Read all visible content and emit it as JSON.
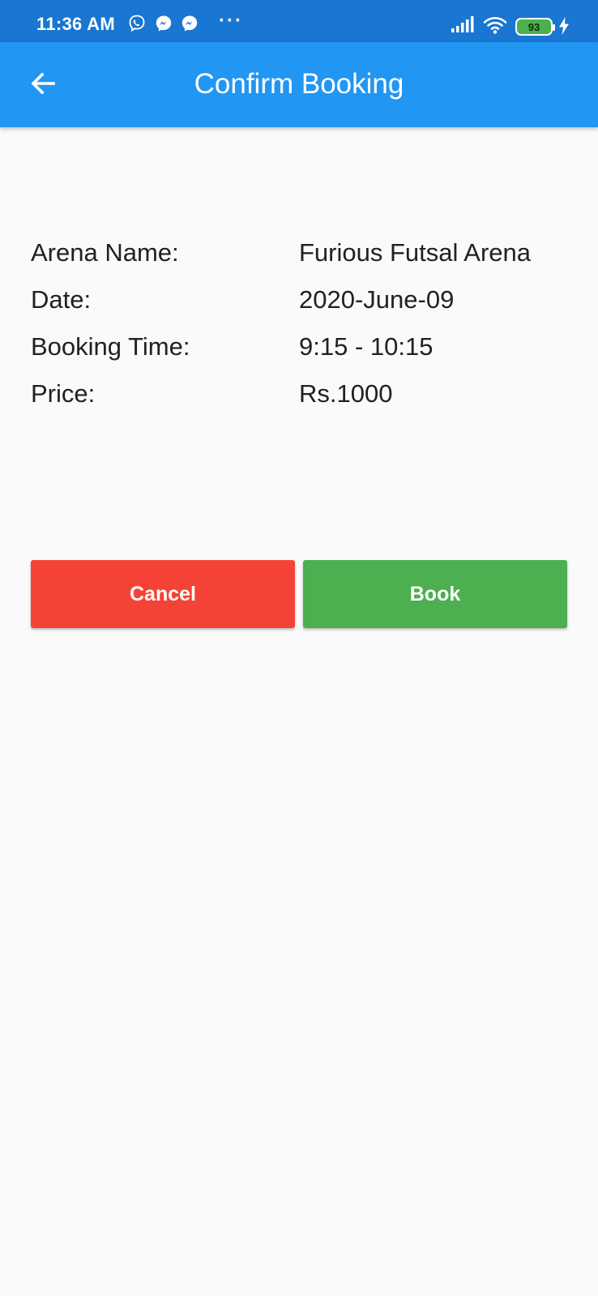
{
  "status_bar": {
    "time": "11:36 AM",
    "more": "···",
    "battery": "93",
    "icons": [
      "viber-icon",
      "messenger-icon",
      "messenger-icon",
      "signal-icon",
      "wifi-icon",
      "battery-icon",
      "charging-icon"
    ]
  },
  "app_bar": {
    "title": "Confirm Booking",
    "back_icon": "arrow-back-icon",
    "color": "#2196f3"
  },
  "details": [
    {
      "label": "Arena Name:",
      "value": "Furious Futsal Arena"
    },
    {
      "label": "Date:",
      "value": "2020-June-09"
    },
    {
      "label": "Booking Time:",
      "value": "9:15 - 10:15"
    },
    {
      "label": "Price:",
      "value": "Rs.1000"
    }
  ],
  "actions": {
    "cancel_label": "Cancel",
    "cancel_color": "#f44336",
    "book_label": "Book",
    "book_color": "#4caf50"
  }
}
